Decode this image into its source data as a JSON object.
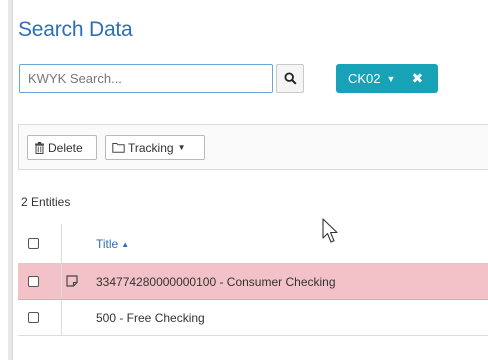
{
  "page": {
    "title": "Search Data"
  },
  "search": {
    "placeholder": "KWYK Search..."
  },
  "filter": {
    "label": "CK02"
  },
  "toolbar": {
    "delete_label": "Delete",
    "tracking_label": "Tracking"
  },
  "entities": {
    "count_label": "2 Entities"
  },
  "table": {
    "columns": [
      "Title"
    ],
    "rows": [
      {
        "title": "334774280000000100 - Consumer Checking",
        "highlighted": true,
        "has_note_icon": true
      },
      {
        "title": "500 - Free Checking",
        "highlighted": false,
        "has_note_icon": false
      }
    ]
  },
  "colors": {
    "title_blue": "#2d6fb7",
    "pill_teal": "#17a2b8",
    "row_highlight": "#f2c2c8",
    "search_border": "#6aa3d8"
  },
  "icons": [
    "search-icon",
    "chevron-down-icon",
    "close-icon",
    "trash-icon",
    "folder-icon",
    "sort-asc-icon",
    "note-icon",
    "mouse-cursor-icon"
  ]
}
